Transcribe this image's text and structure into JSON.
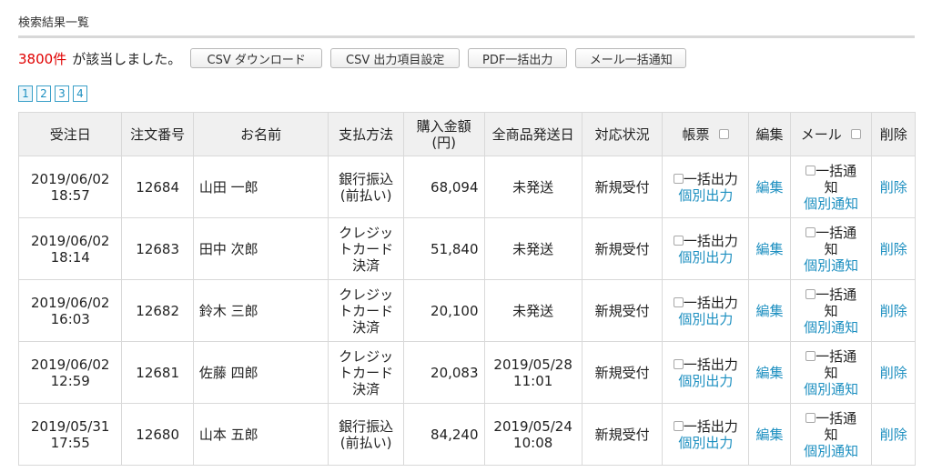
{
  "section_title": "検索結果一覧",
  "results": {
    "count": "3800件",
    "message": "が該当しました。"
  },
  "buttons": {
    "csv_download": "CSV ダウンロード",
    "csv_fields": "CSV 出力項目設定",
    "pdf_bulk": "PDF一括出力",
    "mail_bulk": "メール一括通知"
  },
  "pagination": [
    "1",
    "2",
    "3",
    "4"
  ],
  "columns": {
    "order_date": "受注日",
    "order_no": "注文番号",
    "name": "お名前",
    "payment": "支払方法",
    "amount_l1": "購入金額",
    "amount_l2": "(円)",
    "ship_date": "全商品発送日",
    "status": "対応状況",
    "invoice": "帳票",
    "edit": "編集",
    "mail": "メール",
    "delete": "削除"
  },
  "labels": {
    "bulk_output": "一括出力",
    "individual_output": "個別出力",
    "edit": "編集",
    "bulk_notify_l1": "一括通",
    "bulk_notify_l2": "知",
    "individual_notify": "個別通知",
    "delete": "削除"
  },
  "rows": [
    {
      "date": "2019/06/02",
      "time": "18:57",
      "order_no": "12684",
      "name": "山田 一郎",
      "payment": [
        "銀行振込",
        "(前払い)"
      ],
      "amount": "68,094",
      "ship": [
        "未発送"
      ],
      "status": "新規受付"
    },
    {
      "date": "2019/06/02",
      "time": "18:14",
      "order_no": "12683",
      "name": "田中 次郎",
      "payment": [
        "クレジッ",
        "トカード",
        "決済"
      ],
      "amount": "51,840",
      "ship": [
        "未発送"
      ],
      "status": "新規受付"
    },
    {
      "date": "2019/06/02",
      "time": "16:03",
      "order_no": "12682",
      "name": "鈴木 三郎",
      "payment": [
        "クレジッ",
        "トカード",
        "決済"
      ],
      "amount": "20,100",
      "ship": [
        "未発送"
      ],
      "status": "新規受付"
    },
    {
      "date": "2019/06/02",
      "time": "12:59",
      "order_no": "12681",
      "name": "佐藤 四郎",
      "payment": [
        "クレジッ",
        "トカード",
        "決済"
      ],
      "amount": "20,083",
      "ship": [
        "2019/05/28",
        "11:01"
      ],
      "status": "新規受付"
    },
    {
      "date": "2019/05/31",
      "time": "17:55",
      "order_no": "12680",
      "name": "山本 五郎",
      "payment": [
        "銀行振込",
        "(前払い)"
      ],
      "amount": "84,240",
      "ship": [
        "2019/05/24",
        "10:08"
      ],
      "status": "新規受付"
    }
  ]
}
